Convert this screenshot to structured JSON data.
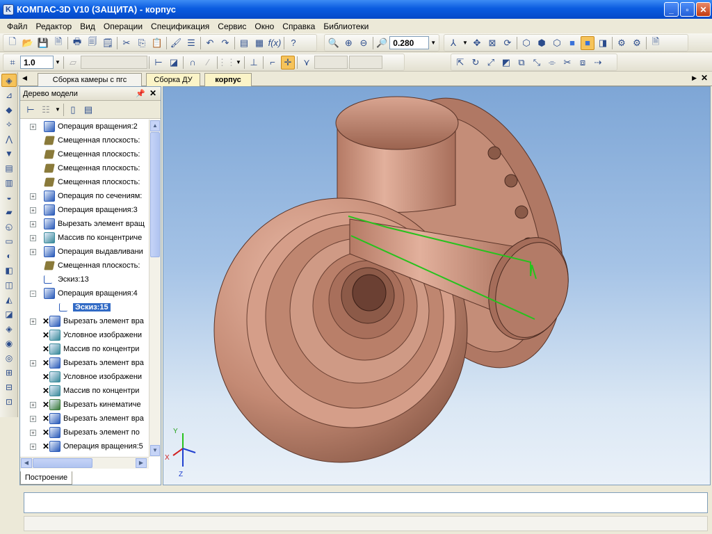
{
  "window": {
    "title": "КОМПАС-3D V10 (ЗАЩИТА) - корпус",
    "minimize": "_",
    "maximize": "▫",
    "close": "✕"
  },
  "menu": [
    "Файл",
    "Редактор",
    "Вид",
    "Операции",
    "Спецификация",
    "Сервис",
    "Окно",
    "Справка",
    "Библиотеки"
  ],
  "toolbar": {
    "zoom_value": "0.280",
    "step_value": "1.0"
  },
  "doc_tabs": [
    {
      "label": "Сборка камеры с пгс",
      "active": false
    },
    {
      "label": "Сборка ДУ",
      "active": false
    },
    {
      "label": "корпус",
      "active": true
    }
  ],
  "tree": {
    "title": "Дерево модели",
    "bottom_tab": "Построение",
    "items": [
      {
        "label": "Операция вращения:2",
        "exp": "+",
        "icon": "revolve-icon",
        "indent": 0,
        "err": false
      },
      {
        "label": "Смещенная плоскость:",
        "exp": "",
        "icon": "plane-icon",
        "indent": 0,
        "err": false
      },
      {
        "label": "Смещенная плоскость:",
        "exp": "",
        "icon": "plane-icon",
        "indent": 0,
        "err": false
      },
      {
        "label": "Смещенная плоскость:",
        "exp": "",
        "icon": "plane-icon",
        "indent": 0,
        "err": false
      },
      {
        "label": "Смещенная плоскость:",
        "exp": "",
        "icon": "plane-icon",
        "indent": 0,
        "err": false
      },
      {
        "label": "Операция по сечениям:",
        "exp": "+",
        "icon": "loft-icon",
        "indent": 0,
        "err": false
      },
      {
        "label": "Операция вращения:3",
        "exp": "+",
        "icon": "revolve-icon",
        "indent": 0,
        "err": false
      },
      {
        "label": "Вырезать элемент вращ",
        "exp": "+",
        "icon": "cut-revolve-icon",
        "indent": 0,
        "err": false
      },
      {
        "label": "Массив по концентриче",
        "exp": "+",
        "icon": "circular-array-icon",
        "indent": 0,
        "err": false
      },
      {
        "label": "Операция выдавливани",
        "exp": "+",
        "icon": "extrude-icon",
        "indent": 0,
        "err": false
      },
      {
        "label": "Смещенная плоскость:",
        "exp": "",
        "icon": "plane-icon",
        "indent": 0,
        "err": false
      },
      {
        "label": "Эскиз:13",
        "exp": "",
        "icon": "sketch-icon",
        "indent": 0,
        "err": false
      },
      {
        "label": "Операция вращения:4",
        "exp": "−",
        "icon": "revolve-icon",
        "indent": 0,
        "err": false
      },
      {
        "label": "Эскиз:15",
        "exp": "",
        "icon": "sketch-icon",
        "indent": 1,
        "err": false,
        "selected": true
      },
      {
        "label": "Вырезать элемент вра",
        "exp": "+",
        "icon": "cut-revolve-icon",
        "indent": 0,
        "err": true
      },
      {
        "label": "Условное изображени",
        "exp": "",
        "icon": "thread-icon",
        "indent": 0,
        "err": true
      },
      {
        "label": "Массив по концентри",
        "exp": "",
        "icon": "circular-array-icon",
        "indent": 0,
        "err": true
      },
      {
        "label": "Вырезать элемент вра",
        "exp": "+",
        "icon": "cut-revolve-icon",
        "indent": 0,
        "err": true
      },
      {
        "label": "Условное изображени",
        "exp": "",
        "icon": "thread-icon",
        "indent": 0,
        "err": true
      },
      {
        "label": "Массив по концентри",
        "exp": "",
        "icon": "circular-array-icon",
        "indent": 0,
        "err": true
      },
      {
        "label": "Вырезать кинематиче",
        "exp": "+",
        "icon": "cut-sweep-icon",
        "indent": 0,
        "err": true
      },
      {
        "label": "Вырезать элемент вра",
        "exp": "+",
        "icon": "cut-revolve-icon",
        "indent": 0,
        "err": true
      },
      {
        "label": "Вырезать элемент по",
        "exp": "+",
        "icon": "cut-loft-icon",
        "indent": 0,
        "err": true
      },
      {
        "label": "Операция вращения:5",
        "exp": "+",
        "icon": "revolve-icon",
        "indent": 0,
        "err": true
      }
    ]
  },
  "triad": {
    "x": "X",
    "y": "Y",
    "z": "Z"
  },
  "colors": {
    "part": "#c8907a",
    "sketch": "#27c21d",
    "selection": "#316ac5"
  }
}
